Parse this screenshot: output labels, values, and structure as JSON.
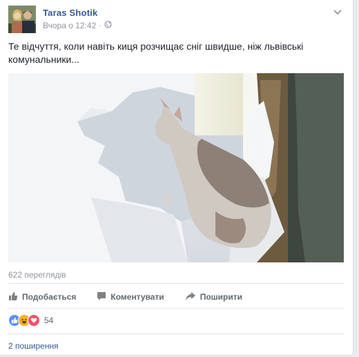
{
  "post": {
    "author": "Taras Shotik",
    "timestamp": "Вчора о 12:42",
    "separator": "·",
    "privacy_icon": "globe-icon",
    "text": "Те відчуття, коли навіть киця розчищає сніг швидше, ніж львівські комунальники..."
  },
  "video": {
    "views": "622 переглядів"
  },
  "actions": {
    "like_label": "Подобається",
    "comment_label": "Коментувати",
    "share_label": "Поширити"
  },
  "reactions": {
    "icons": [
      "like-icon",
      "haha-icon",
      "love-icon"
    ],
    "count": "54"
  },
  "shares": {
    "text": "2 поширення"
  },
  "colors": {
    "link": "#365899",
    "muted": "#90949c",
    "action": "#616770",
    "like_blue": "#5890ff",
    "haha_yellow": "#f7b125",
    "love_red": "#f25268"
  }
}
